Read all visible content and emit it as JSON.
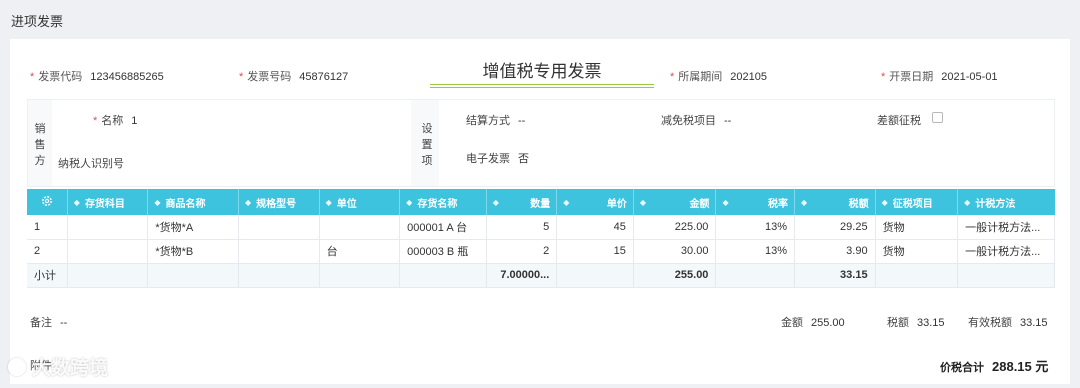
{
  "page": {
    "title": "进项发票"
  },
  "header": {
    "invoice_code_label": "发票代码",
    "invoice_code": "123456885265",
    "invoice_number_label": "发票号码",
    "invoice_number": "45876127",
    "invoice_title": "增值税专用发票",
    "period_label": "所属期间",
    "period": "202105",
    "issue_date_label": "开票日期",
    "issue_date": "2021-05-01"
  },
  "seller": {
    "side_label": "销售方",
    "name_label": "名称",
    "name_value": "1",
    "taxpayer_id_label": "纳税人识别号"
  },
  "settings": {
    "side_label": "设置项",
    "settlement_label": "结算方式",
    "settlement_value": "--",
    "exemption_label": "减免税项目",
    "exemption_value": "--",
    "diff_tax_label": "差额征税",
    "e_invoice_label": "电子发票",
    "e_invoice_value": "否"
  },
  "table": {
    "columns": [
      "存货科目",
      "商品名称",
      "规格型号",
      "单位",
      "存货名称",
      "数量",
      "单价",
      "金额",
      "税率",
      "税额",
      "征税项目",
      "计税方法"
    ],
    "rows": [
      [
        "1",
        "",
        "*货物*A",
        "",
        "",
        "000001 A 台",
        "5",
        "45",
        "225.00",
        "13%",
        "29.25",
        "货物",
        "一般计税方法..."
      ],
      [
        "2",
        "",
        "*货物*B",
        "",
        "台",
        "000003 B 瓶",
        "2",
        "15",
        "30.00",
        "13%",
        "3.90",
        "货物",
        "一般计税方法..."
      ]
    ],
    "subtotal": {
      "label": "小计",
      "quantity": "7.00000...",
      "amount": "255.00",
      "tax": "33.15"
    }
  },
  "footer": {
    "remark_label": "备注",
    "remark_value": "--",
    "amount_label": "金额",
    "amount_value": "255.00",
    "tax_label": "税额",
    "tax_value": "33.15",
    "effective_tax_label": "有效税额",
    "effective_tax_value": "33.15",
    "attachment_label": "附件",
    "total_label": "价税合计",
    "total_value": "288.15 元"
  },
  "watermark": {
    "text": "大数跨境"
  },
  "colors": {
    "header_bg": "#3ec3de",
    "title_underline": "#9bcb3c",
    "required": "#e34d4d"
  }
}
